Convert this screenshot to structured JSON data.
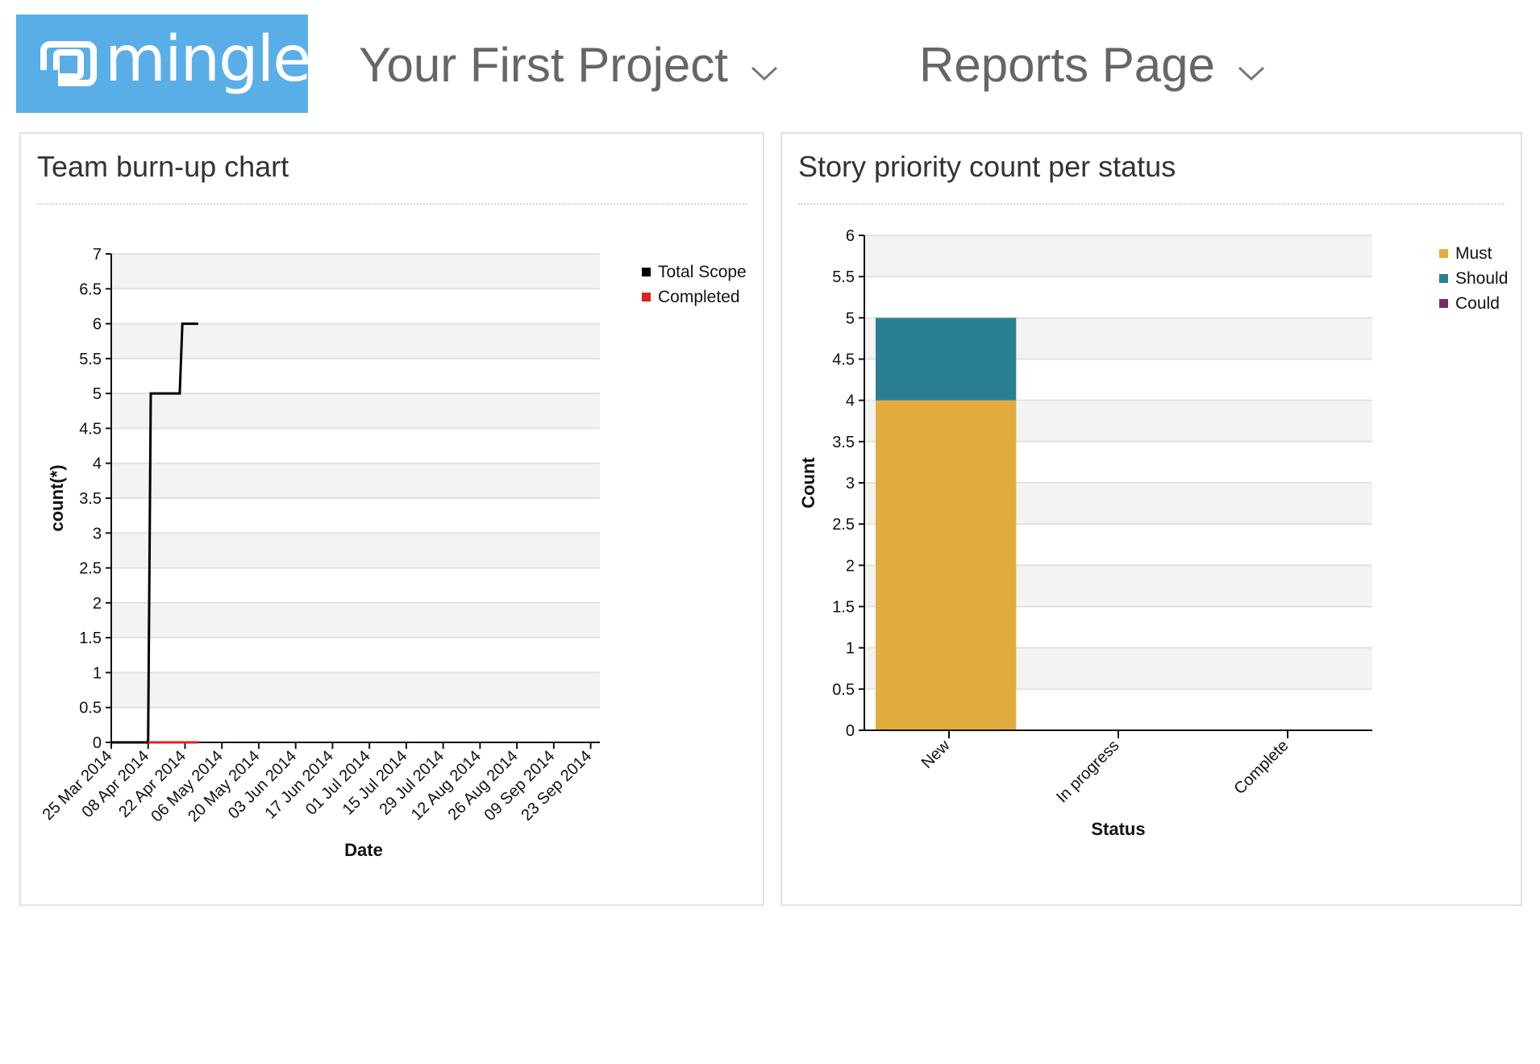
{
  "header": {
    "logo_text": "mingle",
    "logo_tm": "®",
    "project_label": "Your First Project",
    "page_label": "Reports Page"
  },
  "colors": {
    "brand": "#5aaee8",
    "must": "#e3ac3e",
    "should": "#2b7f93",
    "could": "#7b2a6b",
    "total_scope": "#000000",
    "completed": "#e02020"
  },
  "icons": {
    "logo": "mingle-logo-icon",
    "dropdown": "chevron-down-icon"
  },
  "burnup": {
    "title": "Team burn-up chart",
    "chart_data": {
      "type": "line",
      "xlabel": "Date",
      "ylabel": "count(*)",
      "ylim": [
        0,
        7
      ],
      "yticks": [
        "0",
        "0.5",
        "1",
        "1.5",
        "2",
        "2.5",
        "3",
        "3.5",
        "4",
        "4.5",
        "5",
        "5.5",
        "6",
        "6.5",
        "7"
      ],
      "xticks": [
        "25 Mar 2014",
        "08 Apr 2014",
        "22 Apr 2014",
        "06 May 2014",
        "20 May 2014",
        "03 Jun 2014",
        "17 Jun 2014",
        "01 Jul 2014",
        "15 Jul 2014",
        "29 Jul 2014",
        "12 Aug 2014",
        "26 Aug 2014",
        "09 Sep 2014",
        "23 Sep 2014"
      ],
      "grid": true,
      "legend_position": "top-right",
      "series": [
        {
          "name": "Total Scope",
          "color": "#000000",
          "points": [
            [
              "25 Mar 2014",
              0
            ],
            [
              "08 Apr 2014",
              0
            ],
            [
              "09 Apr 2014",
              5
            ],
            [
              "20 Apr 2014",
              5
            ],
            [
              "21 Apr 2014",
              6
            ],
            [
              "27 Apr 2014",
              6
            ]
          ]
        },
        {
          "name": "Completed",
          "color": "#e02020",
          "points": [
            [
              "08 Apr 2014",
              0
            ],
            [
              "27 Apr 2014",
              0
            ]
          ]
        }
      ]
    }
  },
  "priority": {
    "title": "Story priority count per status",
    "chart_data": {
      "type": "bar",
      "stacked": true,
      "xlabel": "Status",
      "ylabel": "Count",
      "ylim": [
        0,
        6
      ],
      "yticks": [
        "0",
        "0.5",
        "1",
        "1.5",
        "2",
        "2.5",
        "3",
        "3.5",
        "4",
        "4.5",
        "5",
        "5.5",
        "6"
      ],
      "categories": [
        "New",
        "In progress",
        "Complete"
      ],
      "grid": true,
      "legend_position": "top-right",
      "series": [
        {
          "name": "Must",
          "color": "#e3ac3e",
          "values": [
            4,
            0,
            0
          ]
        },
        {
          "name": "Should",
          "color": "#2b7f93",
          "values": [
            1,
            0,
            0
          ]
        },
        {
          "name": "Could",
          "color": "#7b2a6b",
          "values": [
            0,
            0,
            0
          ]
        }
      ]
    }
  }
}
